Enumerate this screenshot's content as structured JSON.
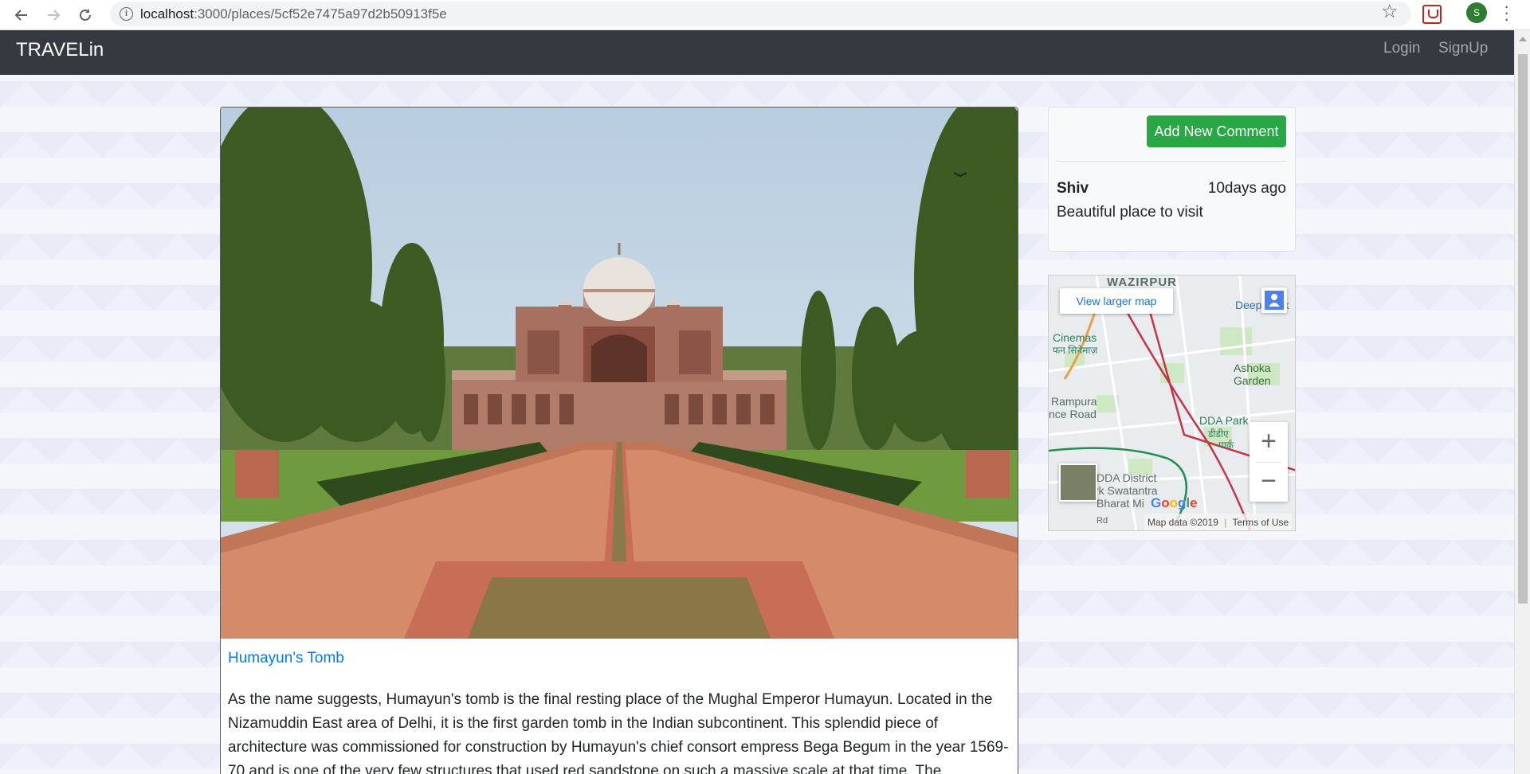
{
  "browser": {
    "url_host": "localhost",
    "url_path": ":3000/places/5cf52e7475a97d2b50913f5e",
    "profile_initial": "S",
    "icons": [
      "back-icon",
      "forward-icon",
      "reload-icon",
      "info-icon",
      "star-icon",
      "extension-icon",
      "menu-icon"
    ]
  },
  "navbar": {
    "brand": "TRAVELin",
    "links": [
      "Login",
      "SignUp"
    ]
  },
  "place": {
    "title": "Humayun's Tomb",
    "description": "As the name suggests, Humayun's tomb is the final resting place of the Mughal Emperor Humayun. Located in the Nizamuddin East area of Delhi, it is the first garden tomb in the Indian subcontinent. This splendid piece of architecture was commissioned for construction by Humayun's chief consort empress Bega Begum in the year 1569-70 and is one of the very few structures that used red sandstone on such a massive scale at that time. The"
  },
  "comments": {
    "add_button": "Add New Comment",
    "items": [
      {
        "author": "Shiv",
        "time": "10days ago",
        "text": "Beautiful place to visit"
      }
    ]
  },
  "map": {
    "view_larger": "View larger map",
    "labels": {
      "wazirpur": "WAZIRPUR",
      "deep": "Deep",
      "park_fragment": "rk",
      "cinemas": "Cinemas",
      "cinemas_hi": "फन सिनेमाज़",
      "ashoka": "Ashoka",
      "garden": "Garden",
      "rampura": "Rampura",
      "nce_road": "nce Road",
      "dda_park": "DDA Park",
      "dda_park_hi_1": "डीडीए",
      "dda_park_hi_2": "पार्क",
      "dda_district": "DDA District",
      "swatantra": "rk Swatantra",
      "bharat": "Bharat Mi",
      "rd": "Rd"
    },
    "zoom_in": "+",
    "zoom_out": "−",
    "data_notice": "Map data ©2019",
    "terms": "Terms of Use",
    "logo": "Google"
  },
  "colors": {
    "navbar_bg": "#343a40",
    "link_blue": "#007bff",
    "add_button_green": "#28a745"
  }
}
